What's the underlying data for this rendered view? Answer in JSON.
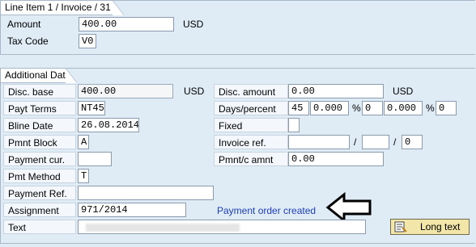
{
  "line_item": {
    "title": "Line Item 1 / Invoice / 31",
    "amount_label": "Amount",
    "amount_value": "400.00",
    "amount_currency": "USD",
    "tax_code_label": "Tax Code",
    "tax_code_value": "V0"
  },
  "additional_data": {
    "title": "Additional Data",
    "disc_base_label": "Disc. base",
    "disc_base_value": "400.00",
    "disc_base_currency": "USD",
    "disc_amount_label": "Disc. amount",
    "disc_amount_value": "0.00",
    "disc_amount_currency": "USD",
    "payt_terms_label": "Payt Terms",
    "payt_terms_value": "NT45",
    "days_percent_label": "Days/percent",
    "days1": "45",
    "pct1": "0.000",
    "pct_sign": "%",
    "days2": "0",
    "pct2": "0.000",
    "days3": "0",
    "bline_date_label": "Bline Date",
    "bline_date_value": "26.08.2014",
    "fixed_label": "Fixed",
    "pmnt_block_label": "Pmnt Block",
    "pmnt_block_value": "A",
    "invoice_ref_label": "Invoice ref.",
    "invoice_ref_slash": "/",
    "invoice_ref_part3": "0",
    "payment_cur_label": "Payment cur.",
    "pmntc_amnt_label": "Pmnt/c amnt",
    "pmntc_amnt_value": "0.00",
    "pmt_method_label": "Pmt Method",
    "pmt_method_value": "T",
    "payment_ref_label": "Payment Ref.",
    "assignment_label": "Assignment",
    "assignment_value": "971/2014",
    "status_message": "Payment order created",
    "text_label": "Text",
    "long_text_button": "Long text"
  },
  "icons": {
    "arrow": "left-arrow-icon",
    "long_text": "document-text-icon"
  },
  "colors": {
    "background": "#dfebf5",
    "status_text": "#1d3fb8",
    "button_bg": "#f2e6a8"
  }
}
